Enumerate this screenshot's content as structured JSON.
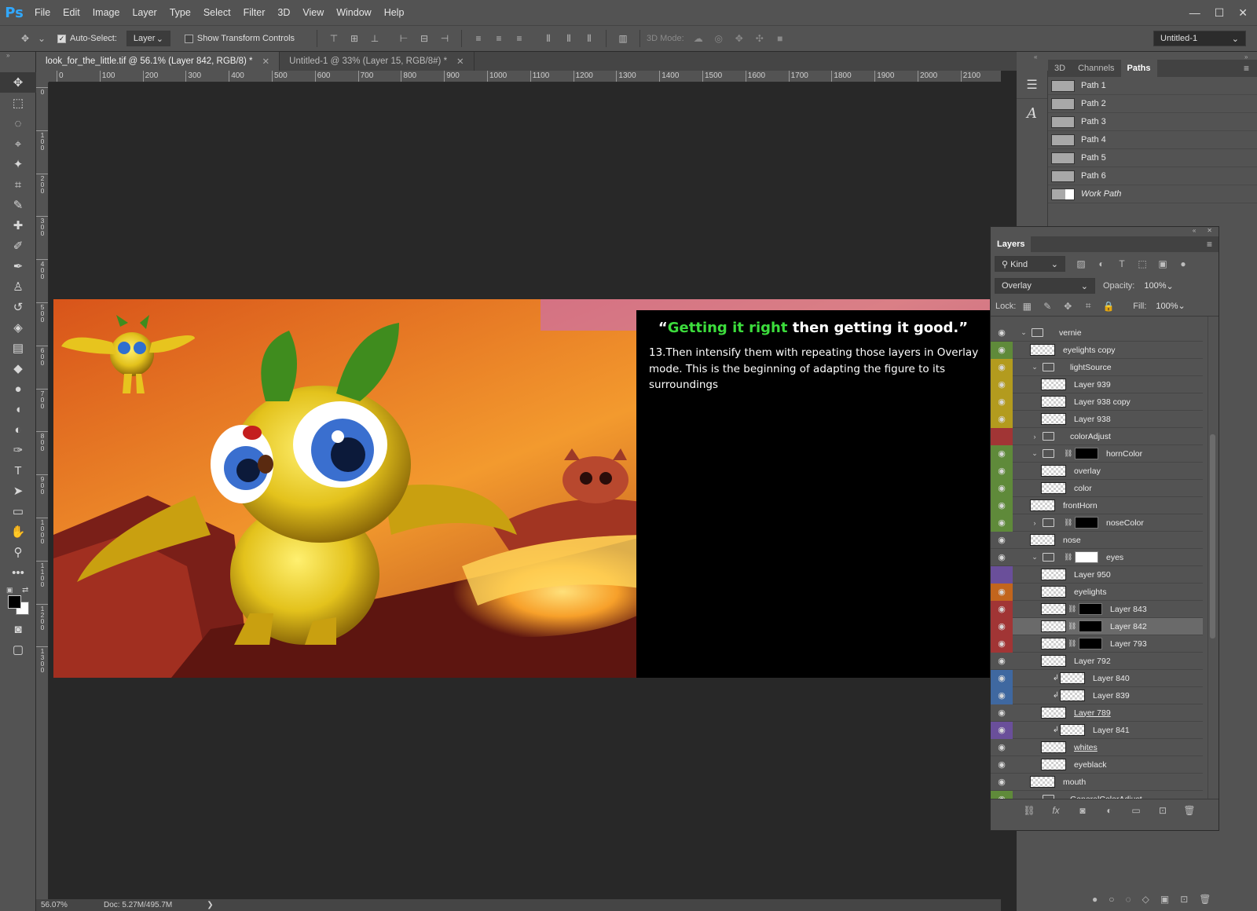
{
  "app": {
    "logo": "Ps"
  },
  "menu": [
    "File",
    "Edit",
    "Image",
    "Layer",
    "Type",
    "Select",
    "Filter",
    "3D",
    "View",
    "Window",
    "Help"
  ],
  "window_controls": {
    "minimize": "—",
    "maximize": "☐",
    "close": "✕"
  },
  "options_bar": {
    "auto_select_label": "Auto-Select:",
    "auto_select_value": "Layer",
    "show_transform_label": "Show Transform Controls",
    "mode_3d_label": "3D Mode:",
    "workspace_value": "Untitled-1"
  },
  "tabs": [
    {
      "label": "look_for_the_little.tif @ 56.1% (Layer 842, RGB/8) *",
      "active": true
    },
    {
      "label": "Untitled-1 @ 33% (Layer 15, RGB/8#) *",
      "active": false
    }
  ],
  "ruler": {
    "h_ticks": [
      "0",
      "100",
      "200",
      "300",
      "400",
      "500",
      "600",
      "700",
      "800",
      "900",
      "1000",
      "1100",
      "1200",
      "1300",
      "1400",
      "1500",
      "1600",
      "1700",
      "1800",
      "1900",
      "2000",
      "2100"
    ],
    "v_ticks": [
      "0",
      "100",
      "200",
      "300",
      "400",
      "500",
      "600",
      "700",
      "800",
      "900",
      "1000",
      "1100",
      "1200",
      "1300"
    ]
  },
  "canvas": {
    "headline_open": "“",
    "headline_green": "Getting it right",
    "headline_white": " then getting it good.”",
    "body": "13.Then intensify them with repeating those layers in Overlay mode.  This is the beginning of adapting the figure to its surroundings"
  },
  "status": {
    "zoom": "56.07%",
    "doc": "Doc: 5.27M/495.7M",
    "arrow": "❯"
  },
  "paths_panel": {
    "tabs": [
      "3D",
      "Channels",
      "Paths"
    ],
    "active_tab": "Paths",
    "items": [
      "Path 1",
      "Path 2",
      "Path 3",
      "Path 4",
      "Path 5",
      "Path 6",
      "Work Path"
    ]
  },
  "layers_panel": {
    "title": "Layers",
    "filter_kind": "Kind",
    "blend_mode": "Overlay",
    "opacity_label": "Opacity:",
    "opacity_value": "100%",
    "lock_label": "Lock:",
    "fill_label": "Fill:",
    "fill_value": "100%",
    "layers": [
      {
        "name": "vernie",
        "indent": 0,
        "type": "group",
        "expanded": true,
        "color": "none",
        "visible": true
      },
      {
        "name": "eyelights copy",
        "indent": 1,
        "type": "layer",
        "color": "#5f8a3a",
        "visible": true
      },
      {
        "name": "lightSource",
        "indent": 1,
        "type": "group",
        "expanded": true,
        "color": "#b39b1e",
        "visible": true
      },
      {
        "name": "Layer 939",
        "indent": 2,
        "type": "layer",
        "color": "#b39b1e",
        "visible": true
      },
      {
        "name": "Layer 938 copy",
        "indent": 2,
        "type": "layer",
        "color": "#b39b1e",
        "visible": true
      },
      {
        "name": "Layer 938",
        "indent": 2,
        "type": "layer",
        "color": "#b39b1e",
        "visible": true
      },
      {
        "name": "colorAdjust",
        "indent": 1,
        "type": "group",
        "expanded": false,
        "color": "#a13535",
        "visible": false
      },
      {
        "name": "hornColor",
        "indent": 1,
        "type": "group",
        "expanded": true,
        "color": "#5f8a3a",
        "visible": true,
        "mask": "black"
      },
      {
        "name": "overlay",
        "indent": 2,
        "type": "layer",
        "color": "#5f8a3a",
        "visible": true
      },
      {
        "name": "color",
        "indent": 2,
        "type": "layer",
        "color": "#5f8a3a",
        "visible": true
      },
      {
        "name": "frontHorn",
        "indent": 1,
        "type": "layer",
        "color": "#5f8a3a",
        "visible": true
      },
      {
        "name": "noseColor",
        "indent": 1,
        "type": "group",
        "expanded": false,
        "color": "#5f8a3a",
        "visible": true,
        "mask": "black"
      },
      {
        "name": "nose",
        "indent": 1,
        "type": "layer",
        "color": "none",
        "visible": true
      },
      {
        "name": "eyes",
        "indent": 1,
        "type": "group",
        "expanded": true,
        "color": "none",
        "visible": true,
        "mask": "white"
      },
      {
        "name": "Layer 950",
        "indent": 2,
        "type": "layer",
        "color": "#6a4f9a",
        "visible": false
      },
      {
        "name": "eyelights",
        "indent": 2,
        "type": "layer",
        "color": "#c2651d",
        "visible": true
      },
      {
        "name": "Layer 843",
        "indent": 2,
        "type": "layer",
        "color": "#a13535",
        "visible": true,
        "mask": "black"
      },
      {
        "name": "Layer 842",
        "indent": 2,
        "type": "layer",
        "color": "#a13535",
        "visible": true,
        "mask": "black",
        "selected": true
      },
      {
        "name": "Layer 793",
        "indent": 2,
        "type": "layer",
        "color": "#a13535",
        "visible": true,
        "mask": "black"
      },
      {
        "name": "Layer 792",
        "indent": 2,
        "type": "layer",
        "color": "none",
        "visible": true
      },
      {
        "name": "Layer 840",
        "indent": 3,
        "type": "layer",
        "color": "#3f68a0",
        "visible": true,
        "clipped": true
      },
      {
        "name": "Layer 839",
        "indent": 3,
        "type": "layer",
        "color": "#3f68a0",
        "visible": true,
        "clipped": true
      },
      {
        "name": "Layer 789",
        "indent": 2,
        "type": "layer",
        "color": "none",
        "visible": true,
        "underline": true
      },
      {
        "name": "Layer 841",
        "indent": 3,
        "type": "layer",
        "color": "#6a4f9a",
        "visible": true,
        "clipped": true
      },
      {
        "name": "whites",
        "indent": 2,
        "type": "layer",
        "color": "none",
        "visible": true,
        "underline": true
      },
      {
        "name": "eyeblack",
        "indent": 2,
        "type": "layer",
        "color": "none",
        "visible": true
      },
      {
        "name": "mouth",
        "indent": 1,
        "type": "layer",
        "color": "none",
        "visible": true
      },
      {
        "name": "GeneralColorAdjust",
        "indent": 1,
        "type": "group",
        "expanded": true,
        "color": "#5f8a3a",
        "visible": true
      }
    ],
    "footer_icons": [
      "link-icon",
      "fx-icon",
      "add-mask-icon",
      "adjustment-icon",
      "new-group-icon",
      "new-layer-icon",
      "trash-icon"
    ]
  },
  "glyphs": {
    "expanded": "⌄",
    "collapsed": "›",
    "link": "⛓",
    "clip": "↲",
    "eye": "👁",
    "close": "✕"
  }
}
